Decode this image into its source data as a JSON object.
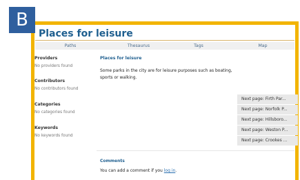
{
  "badge": "B",
  "page": {
    "title": "Places for leisure"
  },
  "nav": {
    "items": [
      "Paths",
      "Thesaurus",
      "Tags",
      "Map"
    ]
  },
  "sidebar": {
    "providers": {
      "heading": "Providers",
      "text": "No providers found"
    },
    "contributors": {
      "heading": "Contributors",
      "text": "No contributors found"
    },
    "categories": {
      "heading": "Categories",
      "text": "No categories found"
    },
    "keywords": {
      "heading": "Keywords",
      "text": "No keywords found"
    }
  },
  "main": {
    "heading": "Places for leisure",
    "description": "Some parks in the city are for leisure purposes such as boating, sports or walking."
  },
  "next_pages": [
    "Next page: Firth Par...",
    "Next page: Norfolk P...",
    "Next page: Hillsboro...",
    "Next page: Weston P...",
    "Next page: Crookes ..."
  ],
  "comments": {
    "heading": "Comments",
    "prefix": "You can add a comment if you ",
    "link": "log in",
    "suffix": "."
  },
  "colors": {
    "accent": "#f2b400",
    "badge": "#2f5f9e",
    "title": "#1f5f8f"
  }
}
